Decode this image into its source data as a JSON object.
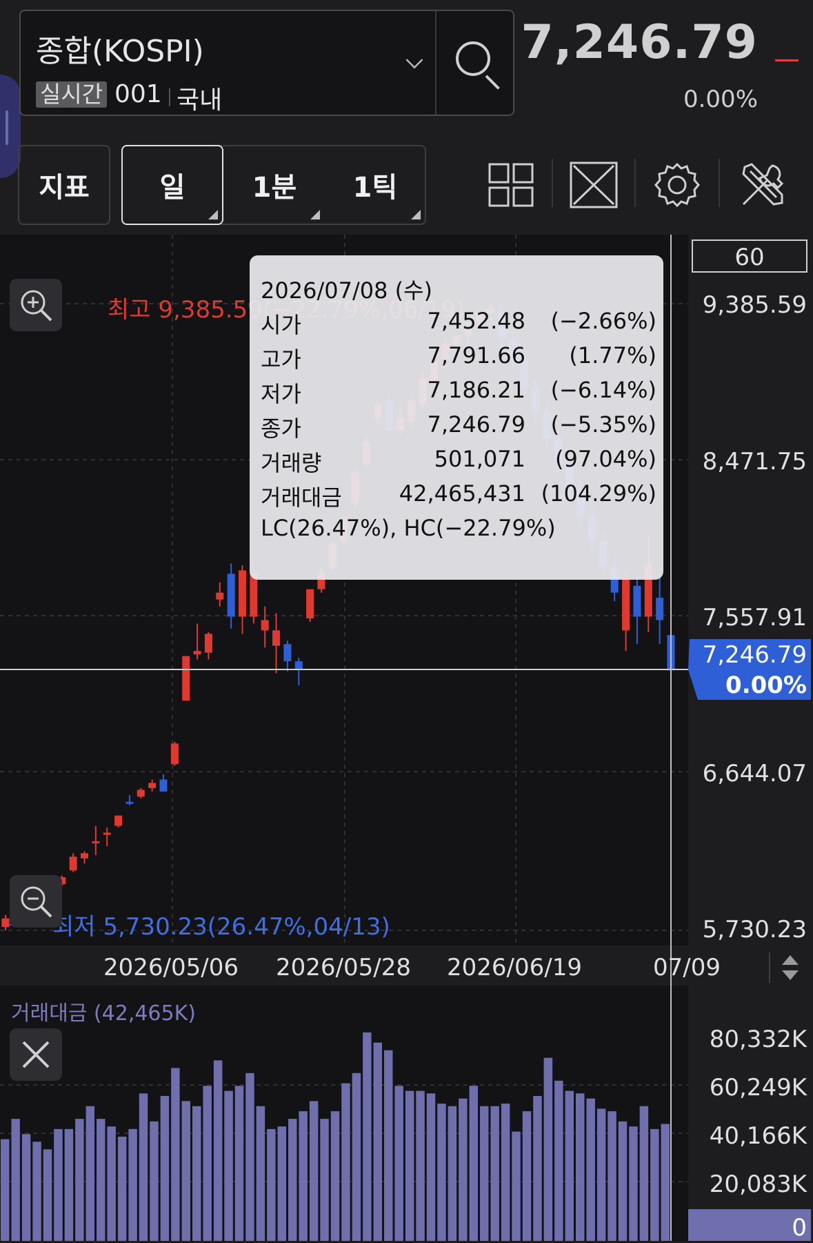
{
  "header": {
    "symbol_name": "종합(KOSPI)",
    "realtime_badge": "실시간",
    "code": "001",
    "market": "국내",
    "price": "7,246.79",
    "change_pct": "0.00%"
  },
  "toolbar": {
    "indicator_label": "지표",
    "period_tabs": [
      {
        "label": "일",
        "selected": true
      },
      {
        "label": "1분",
        "selected": false
      },
      {
        "label": "1틱",
        "selected": false
      }
    ],
    "icons": [
      "grid-layout-icon",
      "fullscreen-icon",
      "gear-icon",
      "tools-icon"
    ]
  },
  "chart": {
    "visible_count": "60",
    "price_axis_labels": [
      "9,385.59",
      "8,471.75",
      "7,557.91",
      "6,644.07",
      "5,730.23"
    ],
    "current_price_tag": "7,246.79",
    "current_pct_tag": "0.00%",
    "high_label": "최고 9,385.59(−22.79%,06/19)",
    "low_label": "최저 5,730.23(26.47%,04/13)",
    "date_labels": [
      "2026/05/06",
      "2026/05/28",
      "2026/06/19",
      "07/09"
    ],
    "volume_title": "거래대금 (42,465K)",
    "volume_axis_labels": [
      "80,332K",
      "60,249K",
      "40,166K",
      "20,083K",
      "0"
    ]
  },
  "tooltip": {
    "date": "2026/07/08 (수)",
    "rows": [
      {
        "label": "시가",
        "value": "7,452.48",
        "pct": "(−2.66%)"
      },
      {
        "label": "고가",
        "value": "7,791.66",
        "pct": "(1.77%)"
      },
      {
        "label": "저가",
        "value": "7,186.21",
        "pct": "(−6.14%)"
      },
      {
        "label": "종가",
        "value": "7,246.79",
        "pct": "(−5.35%)"
      },
      {
        "label": "거래량",
        "value": "501,071",
        "pct": "(97.04%)"
      },
      {
        "label": "거래대금",
        "value": "42,465,431",
        "pct": "(104.29%)"
      }
    ],
    "footer": "LC(26.47%), HC(−22.79%)"
  },
  "colors": {
    "up": "#e0392f",
    "down": "#2f5fd6",
    "volume": "#6f6fae",
    "price_tag_bg": "#2f5fd6"
  },
  "chart_data": {
    "type": "candlestick",
    "ylim": [
      5730.23,
      9385.59
    ],
    "candles": [
      {
        "o": 5750,
        "h": 5820,
        "l": 5730,
        "c": 5800
      },
      {
        "o": 5880,
        "h": 5950,
        "l": 5860,
        "c": 5930
      },
      {
        "o": 5960,
        "h": 6010,
        "l": 5930,
        "c": 5920
      },
      {
        "o": 5950,
        "h": 6020,
        "l": 5930,
        "c": 5990
      },
      {
        "o": 5990,
        "h": 6030,
        "l": 5960,
        "c": 5970
      },
      {
        "o": 6000,
        "h": 6050,
        "l": 5990,
        "c": 6040
      },
      {
        "o": 6080,
        "h": 6180,
        "l": 6070,
        "c": 6160
      },
      {
        "o": 6150,
        "h": 6190,
        "l": 6120,
        "c": 6180
      },
      {
        "o": 6250,
        "h": 6340,
        "l": 6170,
        "c": 6250
      },
      {
        "o": 6290,
        "h": 6330,
        "l": 6220,
        "c": 6300
      },
      {
        "o": 6340,
        "h": 6400,
        "l": 6330,
        "c": 6400
      },
      {
        "o": 6480,
        "h": 6520,
        "l": 6460,
        "c": 6470
      },
      {
        "o": 6510,
        "h": 6560,
        "l": 6500,
        "c": 6550
      },
      {
        "o": 6560,
        "h": 6610,
        "l": 6540,
        "c": 6590
      },
      {
        "o": 6610,
        "h": 6640,
        "l": 6600,
        "c": 6540
      },
      {
        "o": 6700,
        "h": 6830,
        "l": 6690,
        "c": 6820
      },
      {
        "o": 7070,
        "h": 7330,
        "l": 7070,
        "c": 7330
      },
      {
        "o": 7340,
        "h": 7520,
        "l": 7310,
        "c": 7360
      },
      {
        "o": 7350,
        "h": 7470,
        "l": 7310,
        "c": 7460
      },
      {
        "o": 7660,
        "h": 7760,
        "l": 7620,
        "c": 7700
      },
      {
        "o": 7810,
        "h": 7870,
        "l": 7490,
        "c": 7560
      },
      {
        "o": 7560,
        "h": 7860,
        "l": 7460,
        "c": 7830
      },
      {
        "o": 7560,
        "h": 7880,
        "l": 7520,
        "c": 7810
      },
      {
        "o": 7480,
        "h": 7620,
        "l": 7380,
        "c": 7540
      },
      {
        "o": 7390,
        "h": 7580,
        "l": 7230,
        "c": 7480
      },
      {
        "o": 7400,
        "h": 7420,
        "l": 7240,
        "c": 7300
      },
      {
        "o": 7300,
        "h": 7320,
        "l": 7160,
        "c": 7250
      },
      {
        "o": 7550,
        "h": 7720,
        "l": 7530,
        "c": 7720
      },
      {
        "o": 7720,
        "h": 7840,
        "l": 7700,
        "c": 7820
      },
      {
        "o": 7840,
        "h": 8000,
        "l": 7820,
        "c": 7990
      },
      {
        "o": 8000,
        "h": 8140,
        "l": 7990,
        "c": 8140
      },
      {
        "o": 8220,
        "h": 8420,
        "l": 8200,
        "c": 8400
      },
      {
        "o": 8450,
        "h": 8600,
        "l": 8440,
        "c": 8580
      },
      {
        "o": 8720,
        "h": 8820,
        "l": 8680,
        "c": 8800
      },
      {
        "o": 8820,
        "h": 8880,
        "l": 8780,
        "c": 8650
      },
      {
        "o": 8650,
        "h": 8780,
        "l": 8620,
        "c": 8720
      },
      {
        "o": 8700,
        "h": 8840,
        "l": 8660,
        "c": 8820
      },
      {
        "o": 8800,
        "h": 9000,
        "l": 8780,
        "c": 8950
      },
      {
        "o": 8930,
        "h": 9060,
        "l": 8900,
        "c": 9050
      },
      {
        "o": 9060,
        "h": 9180,
        "l": 9020,
        "c": 9150
      },
      {
        "o": 9150,
        "h": 9200,
        "l": 9100,
        "c": 9190
      },
      {
        "o": 9200,
        "h": 9280,
        "l": 9150,
        "c": 9250
      },
      {
        "o": 9280,
        "h": 9340,
        "l": 9240,
        "c": 9330
      },
      {
        "o": 9330,
        "h": 9385,
        "l": 9280,
        "c": 9360
      },
      {
        "o": 9340,
        "h": 9385,
        "l": 9100,
        "c": 9180
      },
      {
        "o": 9180,
        "h": 9220,
        "l": 9000,
        "c": 9050
      },
      {
        "o": 9050,
        "h": 9100,
        "l": 8850,
        "c": 8900
      },
      {
        "o": 8900,
        "h": 8950,
        "l": 8700,
        "c": 8750
      },
      {
        "o": 8750,
        "h": 8800,
        "l": 8550,
        "c": 8600
      },
      {
        "o": 8600,
        "h": 8650,
        "l": 8400,
        "c": 8450
      },
      {
        "o": 8450,
        "h": 8500,
        "l": 8250,
        "c": 8300
      },
      {
        "o": 8300,
        "h": 8350,
        "l": 8100,
        "c": 8150
      },
      {
        "o": 8150,
        "h": 8200,
        "l": 7950,
        "c": 8000
      },
      {
        "o": 8000,
        "h": 8050,
        "l": 7800,
        "c": 7850
      },
      {
        "o": 7850,
        "h": 7900,
        "l": 7650,
        "c": 7700
      },
      {
        "o": 7480,
        "h": 7820,
        "l": 7360,
        "c": 7780
      },
      {
        "o": 7740,
        "h": 7800,
        "l": 7400,
        "c": 7560
      },
      {
        "o": 7560,
        "h": 8040,
        "l": 7470,
        "c": 7870
      },
      {
        "o": 7670,
        "h": 7800,
        "l": 7400,
        "c": 7540
      },
      {
        "o": 7452.48,
        "h": 7791.66,
        "l": 7186.21,
        "c": 7246.79
      }
    ],
    "volume": [
      40,
      48,
      42,
      39,
      36,
      44,
      44,
      48,
      53,
      48,
      45,
      41,
      44,
      58,
      47,
      57,
      68,
      55,
      53,
      61,
      71,
      59,
      61,
      66,
      53,
      44,
      45,
      48,
      51,
      55,
      48,
      51,
      62,
      66,
      82,
      78,
      75,
      61,
      59,
      59,
      58,
      54,
      53,
      56,
      61,
      53,
      53,
      54,
      43,
      51,
      57,
      72,
      63,
      59,
      58,
      56,
      52,
      51,
      47,
      45,
      53,
      44,
      46
    ]
  }
}
